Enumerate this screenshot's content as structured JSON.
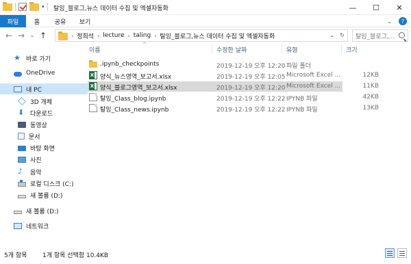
{
  "window": {
    "title": "탈잉_블로그,뉴스 데이터 수집 및 엑셀자동화",
    "qat_dropdown": "▾",
    "minimize": "—",
    "maximize": "☐",
    "close": "✕"
  },
  "ribbon": {
    "tabs": [
      "파일",
      "홈",
      "공유",
      "보기"
    ],
    "expand": "⌄",
    "help": "?"
  },
  "nav": {
    "back": "←",
    "forward": "→",
    "recent": "⌄",
    "up": "↑"
  },
  "address": {
    "crumbs": [
      "정희석",
      "lecture",
      "taling",
      "탈잉_블로그,뉴스 데이터 수집 및 엑셀자동화"
    ],
    "separator": "›",
    "dropdown": "⌄",
    "refresh": "↻"
  },
  "search": {
    "placeholder": "탈잉_블로그,..."
  },
  "sidebar": {
    "items": [
      {
        "label": "바로 가기",
        "icon": "star-icon"
      },
      {
        "label": "OneDrive",
        "icon": "cloud-icon"
      },
      {
        "label": "내 PC",
        "icon": "pc-icon"
      },
      {
        "label": "3D 개체",
        "icon": "cube-icon"
      },
      {
        "label": "다운로드",
        "icon": "download-icon"
      },
      {
        "label": "동영상",
        "icon": "video-icon"
      },
      {
        "label": "문서",
        "icon": "document-icon"
      },
      {
        "label": "바탕 화면",
        "icon": "desktop-icon"
      },
      {
        "label": "사진",
        "icon": "picture-icon"
      },
      {
        "label": "음악",
        "icon": "music-icon"
      },
      {
        "label": "로컬 디스크 (C:)",
        "icon": "disk-icon"
      },
      {
        "label": "새 볼륨 (D:)",
        "icon": "drive-icon"
      },
      {
        "label": "새 볼륨 (D:)",
        "icon": "drive-icon"
      },
      {
        "label": "네트워크",
        "icon": "network-icon"
      }
    ]
  },
  "list": {
    "headers": {
      "name": "이름",
      "modified": "수정한 날짜",
      "type": "유형",
      "size": "크기"
    },
    "sort_indicator": "^",
    "rows": [
      {
        "name": ".ipynb_checkpoints",
        "modified": "2019-12-19 오후 12:20",
        "type": "파일 폴더",
        "size": "",
        "icon": "folder-icon"
      },
      {
        "name": "양식_뉴스영역_보고서.xlsx",
        "modified": "2019-12-19 오후 12:05",
        "type": "Microsoft Excel ...",
        "size": "12KB",
        "icon": "excel-icon"
      },
      {
        "name": "양식_블로그영역_보고서.xlsx",
        "modified": "2019-12-19 오후 12:20",
        "type": "Microsoft Excel ...",
        "size": "11KB",
        "icon": "excel-icon"
      },
      {
        "name": "탈잉_Class_blog.ipynb",
        "modified": "2019-12-19 오후 12:22",
        "type": "IPYNB 파일",
        "size": "42KB",
        "icon": "file-icon"
      },
      {
        "name": "탈잉_Class_news.ipynb",
        "modified": "2019-12-19 오후 12:22",
        "type": "IPYNB 파일",
        "size": "13KB",
        "icon": "file-icon"
      }
    ]
  },
  "status": {
    "count": "5개 항목",
    "selection": "1개 항목 선택함 10.4KB"
  },
  "colors": {
    "accent": "#1979ca",
    "selected_row": "#d9d9d9",
    "selected_nav": "#cce4f7"
  }
}
